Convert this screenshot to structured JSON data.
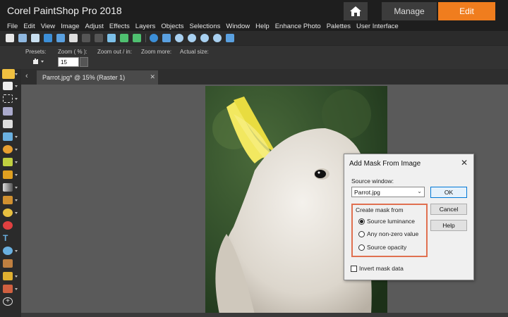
{
  "app": {
    "title": "Corel PaintShop Pro 2018"
  },
  "workspace_tabs": {
    "manage": "Manage",
    "edit": "Edit"
  },
  "menu": [
    "File",
    "Edit",
    "View",
    "Image",
    "Adjust",
    "Effects",
    "Layers",
    "Objects",
    "Selections",
    "Window",
    "Help",
    "Enhance Photo",
    "Palettes",
    "User Interface"
  ],
  "options_bar": {
    "presets_label": "Presets:",
    "zoom_label": "Zoom ( % ):",
    "zoom_value": "15",
    "zoom_out_in_label": "Zoom out / in:",
    "zoom_more_label": "Zoom more:",
    "actual_size_label": "Actual size:"
  },
  "document": {
    "tab_label": "Parrot.jpg* @  15% (Raster 1)"
  },
  "dialog": {
    "title": "Add Mask From Image",
    "source_window_label": "Source window:",
    "source_window_value": "Parrot.jpg",
    "ok_label": "OK",
    "cancel_label": "Cancel",
    "help_label": "Help",
    "group_label": "Create mask from",
    "options": [
      "Source luminance",
      "Any non-zero value",
      "Source opacity"
    ],
    "selected_option": "Source luminance",
    "invert_label": "Invert mask data",
    "invert_checked": false
  },
  "colors": {
    "accent": "#f07d1e",
    "highlight_box": "#e07050"
  }
}
